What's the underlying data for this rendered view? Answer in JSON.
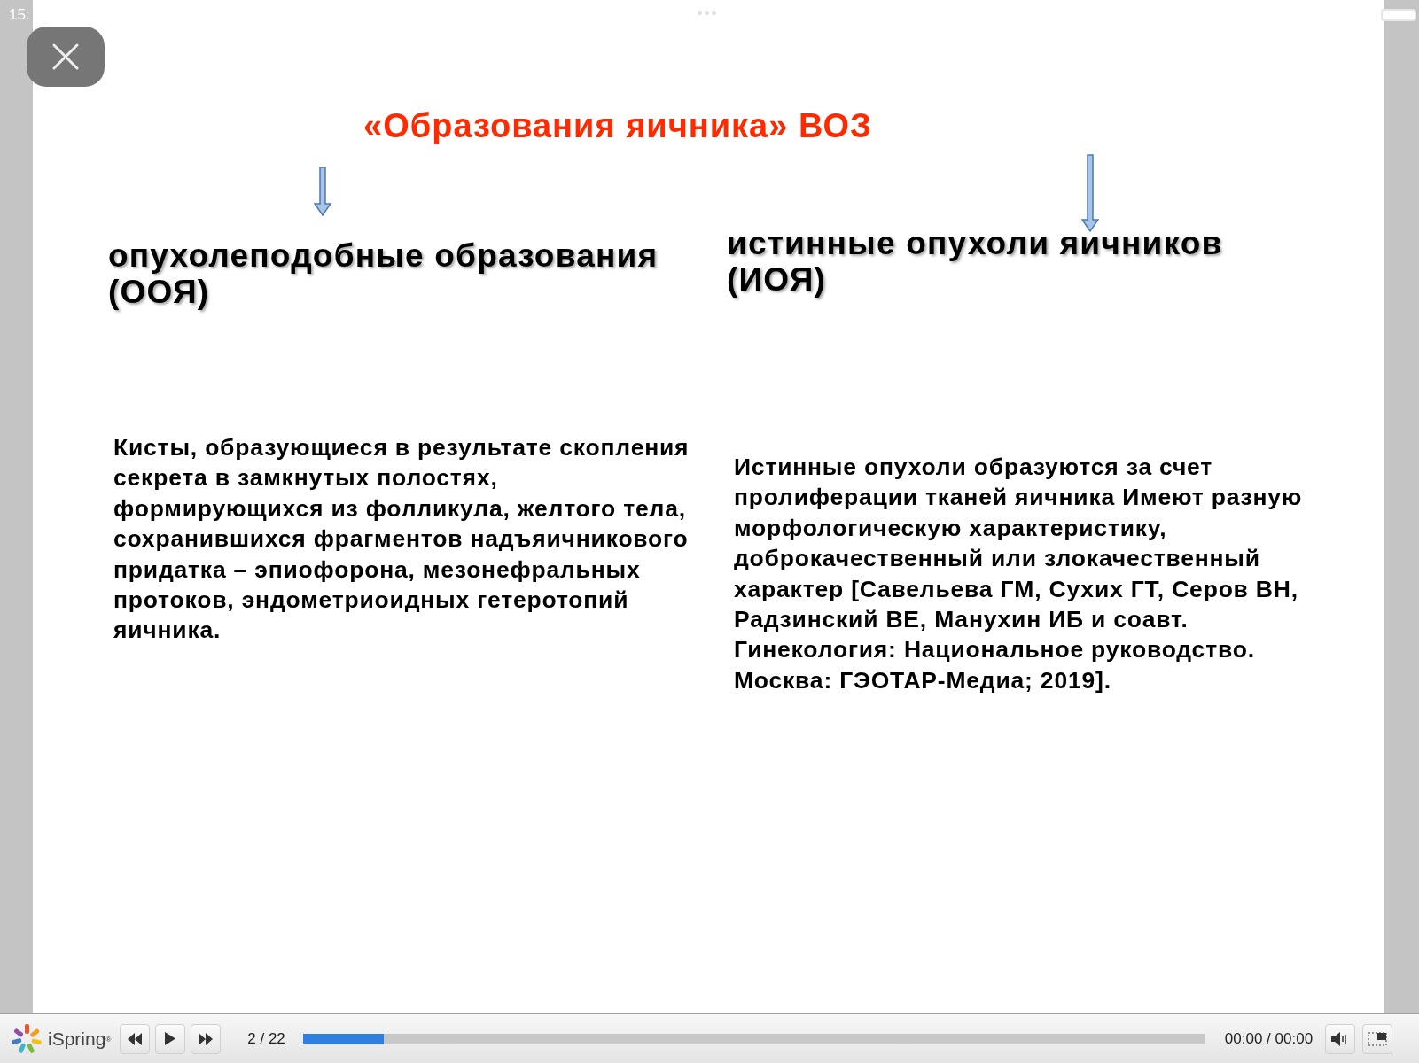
{
  "status_bar": {
    "time": "15:"
  },
  "slide": {
    "title": "«Образования яичника» ВОЗ",
    "columns": [
      {
        "heading": "опухолеподобные образования (ООЯ)",
        "body": "Кисты, образующиеся в результате скопления секрета в замкнутых полостях, формирующихся из фолликула, желтого тела, сохранившихся фрагментов надъяичникового придатка – эпиофорона, мезонефральных протоков, эндометриоидных гетеротопий яичника."
      },
      {
        "heading": "истинные опухоли яичников (ИОЯ)",
        "body": "Истинные опухоли образуются за счет пролиферации тканей яичника Имеют разную морфологическую характеристику, доброкачественный или злокачественный характер [Савельева ГМ, Сухих ГТ, Серов ВН, Радзинский ВЕ, Манухин ИБ и соавт. Гинекология: Национальное руководство. Москва: ГЭОТАР-Медиа; 2019]."
      }
    ]
  },
  "player": {
    "brand": "iSpring",
    "brand_mark": "®",
    "slide_counter": "2 / 22",
    "progress": {
      "level": 0.09
    },
    "time": "00:00 / 00:00"
  }
}
